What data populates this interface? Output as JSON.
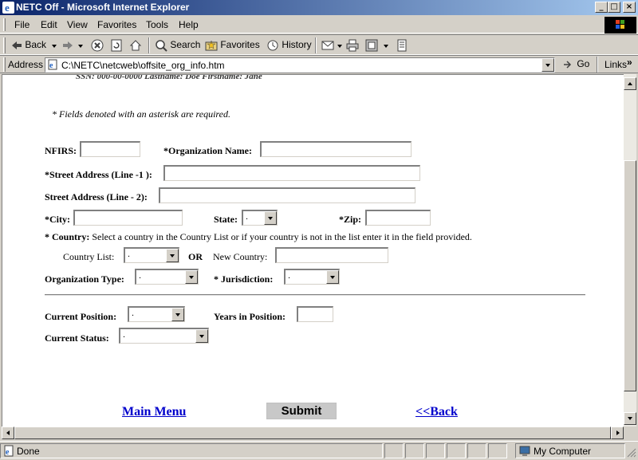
{
  "window": {
    "title": "NETC Off - Microsoft Internet Explorer",
    "buttons": {
      "minimize": "_",
      "maximize": "□",
      "close": "×"
    }
  },
  "menu": {
    "items": [
      {
        "label": "File"
      },
      {
        "label": "Edit"
      },
      {
        "label": "View"
      },
      {
        "label": "Favorites"
      },
      {
        "label": "Tools"
      },
      {
        "label": "Help"
      }
    ]
  },
  "toolbar": {
    "back": "Back",
    "search": "Search",
    "favorites": "Favorites",
    "history": "History"
  },
  "address": {
    "label": "Address",
    "url": "C:\\NETC\\netcweb\\offsite_org_info.htm",
    "go": "Go",
    "links": "Links"
  },
  "page": {
    "partial_header": "SSN: 000-00-0000          Lastname: Doe                 Firstname: Jane",
    "required_note": "* Fields denoted with an asterisk are required.",
    "fields": {
      "nfirs": "NFIRS:",
      "org_name": "*Organization Name:",
      "street1": "*Street Address (Line -1 ):",
      "street2": "Street Address (Line - 2):",
      "city": "*City:",
      "state": "State:",
      "state_value": ".",
      "zip": "*Zip:",
      "country_label": "* Country:",
      "country_text": "Select a country in the Country List or if your country is not in the list enter it in the field provided.",
      "country_list": "Country List:",
      "country_list_value": ".",
      "or": "OR",
      "new_country": "New Country:",
      "org_type": "Organization Type:",
      "org_type_value": ".",
      "jurisdiction": "* Jurisdiction:",
      "jurisdiction_value": ".",
      "current_position": "Current Position:",
      "current_position_value": ".",
      "years_in_position": "Years in Position:",
      "current_status": "Current Status:",
      "current_status_value": "."
    },
    "links": {
      "main_menu": "Main Menu",
      "submit": "Submit",
      "back": "<<Back"
    }
  },
  "status": {
    "text": "Done",
    "zone": "My Computer"
  }
}
